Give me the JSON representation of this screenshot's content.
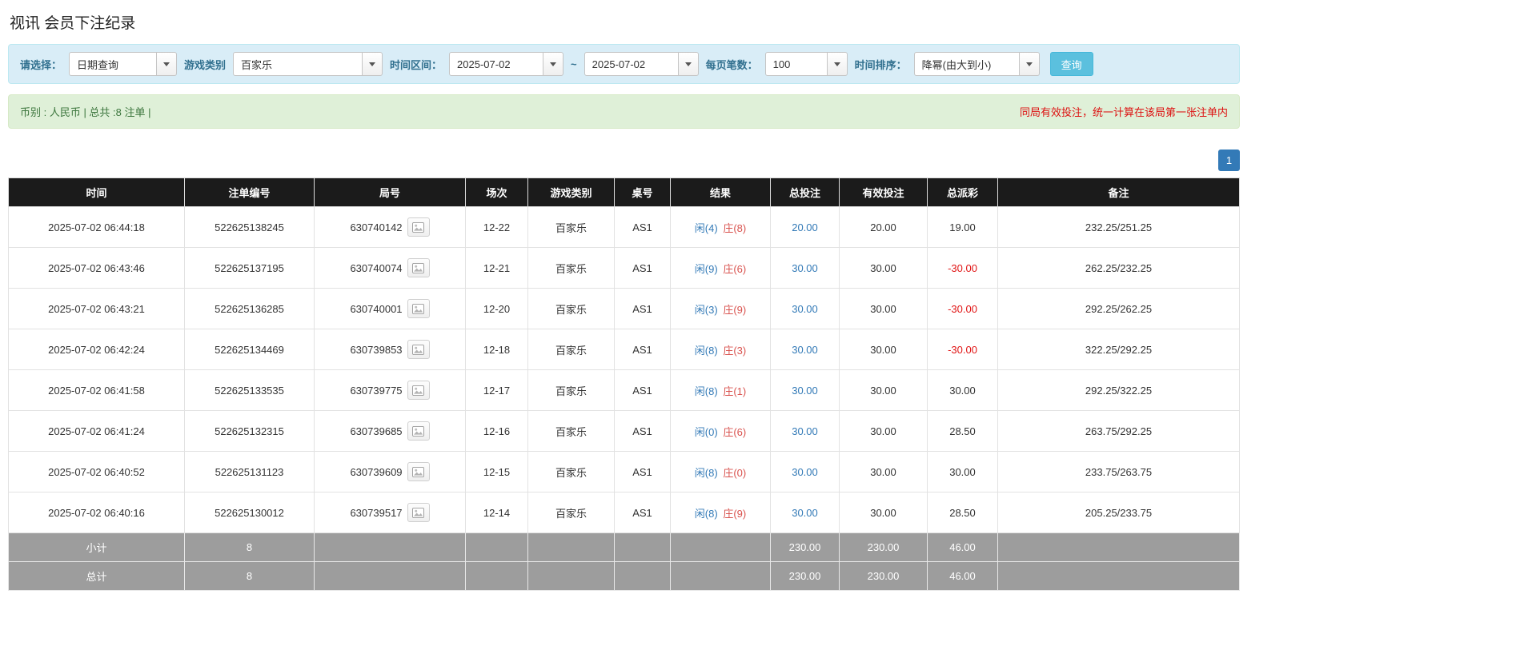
{
  "page": {
    "title": "视讯 会员下注纪录"
  },
  "filters": {
    "query_type": {
      "label": "请选择：",
      "value": "日期查询"
    },
    "game_type": {
      "label": "游戏类别",
      "value": "百家乐"
    },
    "date_range": {
      "label": "时间区间：",
      "from": "2025-07-02",
      "separator": "~",
      "to": "2025-07-02"
    },
    "page_size": {
      "label": "每页笔数：",
      "value": "100"
    },
    "sort": {
      "label": "时间排序：",
      "value": "降幂(由大到小)"
    },
    "search_button": "查询"
  },
  "summary": {
    "left": "币别 : 人民币 | 总共 :8 注单 |",
    "note": "同局有效投注，统一计算在该局第一张注单内"
  },
  "pagination": {
    "current_page": "1"
  },
  "icons": {
    "combobox_caret": "caret-down",
    "round_preview": "image-thumbnail"
  },
  "colors": {
    "player_blue": "#337ab7",
    "banker_red": "#d9534f",
    "link_blue": "#337ab7",
    "negative_red": "#e01414",
    "header_bg": "#1b1b1b",
    "footer_bg": "#9d9d9d",
    "filter_bar_bg": "#d9edf7",
    "summary_bar_bg": "#dff0d8",
    "search_button_bg": "#5bc0de",
    "pagination_bg": "#337ab7"
  },
  "table": {
    "headers": [
      "时间",
      "注单编号",
      "局号",
      "场次",
      "游戏类别",
      "桌号",
      "结果",
      "总投注",
      "有效投注",
      "总派彩",
      "备注"
    ],
    "rows": [
      {
        "time": "2025-07-02 06:44:18",
        "bet_id": "522625138245",
        "round": "630740142",
        "session": "12-22",
        "game": "百家乐",
        "table_no": "AS1",
        "result_player": "闲(4)",
        "result_banker": "庄(8)",
        "total_bet": "20.00",
        "valid_bet": "20.00",
        "payout": "19.00",
        "note": "232.25/251.25"
      },
      {
        "time": "2025-07-02 06:43:46",
        "bet_id": "522625137195",
        "round": "630740074",
        "session": "12-21",
        "game": "百家乐",
        "table_no": "AS1",
        "result_player": "闲(9)",
        "result_banker": "庄(6)",
        "total_bet": "30.00",
        "valid_bet": "30.00",
        "payout": "-30.00",
        "note": "262.25/232.25"
      },
      {
        "time": "2025-07-02 06:43:21",
        "bet_id": "522625136285",
        "round": "630740001",
        "session": "12-20",
        "game": "百家乐",
        "table_no": "AS1",
        "result_player": "闲(3)",
        "result_banker": "庄(9)",
        "total_bet": "30.00",
        "valid_bet": "30.00",
        "payout": "-30.00",
        "note": "292.25/262.25"
      },
      {
        "time": "2025-07-02 06:42:24",
        "bet_id": "522625134469",
        "round": "630739853",
        "session": "12-18",
        "game": "百家乐",
        "table_no": "AS1",
        "result_player": "闲(8)",
        "result_banker": "庄(3)",
        "total_bet": "30.00",
        "valid_bet": "30.00",
        "payout": "-30.00",
        "note": "322.25/292.25"
      },
      {
        "time": "2025-07-02 06:41:58",
        "bet_id": "522625133535",
        "round": "630739775",
        "session": "12-17",
        "game": "百家乐",
        "table_no": "AS1",
        "result_player": "闲(8)",
        "result_banker": "庄(1)",
        "total_bet": "30.00",
        "valid_bet": "30.00",
        "payout": "30.00",
        "note": "292.25/322.25"
      },
      {
        "time": "2025-07-02 06:41:24",
        "bet_id": "522625132315",
        "round": "630739685",
        "session": "12-16",
        "game": "百家乐",
        "table_no": "AS1",
        "result_player": "闲(0)",
        "result_banker": "庄(6)",
        "total_bet": "30.00",
        "valid_bet": "30.00",
        "payout": "28.50",
        "note": "263.75/292.25"
      },
      {
        "time": "2025-07-02 06:40:52",
        "bet_id": "522625131123",
        "round": "630739609",
        "session": "12-15",
        "game": "百家乐",
        "table_no": "AS1",
        "result_player": "闲(8)",
        "result_banker": "庄(0)",
        "total_bet": "30.00",
        "valid_bet": "30.00",
        "payout": "30.00",
        "note": "233.75/263.75"
      },
      {
        "time": "2025-07-02 06:40:16",
        "bet_id": "522625130012",
        "round": "630739517",
        "session": "12-14",
        "game": "百家乐",
        "table_no": "AS1",
        "result_player": "闲(8)",
        "result_banker": "庄(9)",
        "total_bet": "30.00",
        "valid_bet": "30.00",
        "payout": "28.50",
        "note": "205.25/233.75"
      }
    ],
    "subtotal": {
      "label": "小计",
      "count": "8",
      "total_bet": "230.00",
      "valid_bet": "230.00",
      "payout": "46.00"
    },
    "total": {
      "label": "总计",
      "count": "8",
      "total_bet": "230.00",
      "valid_bet": "230.00",
      "payout": "46.00"
    }
  }
}
